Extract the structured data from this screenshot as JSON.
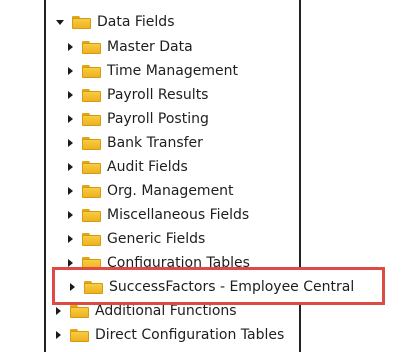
{
  "tree": {
    "root": {
      "label": "Data Fields",
      "expanded": true
    },
    "children": [
      {
        "label": "Master Data"
      },
      {
        "label": "Time Management"
      },
      {
        "label": "Payroll Results"
      },
      {
        "label": "Payroll Posting"
      },
      {
        "label": "Bank Transfer"
      },
      {
        "label": "Audit Fields"
      },
      {
        "label": "Org. Management"
      },
      {
        "label": "Miscellaneous Fields"
      },
      {
        "label": "Generic Fields"
      },
      {
        "label": "Configuration Tables"
      },
      {
        "label": "SuccessFactors - Employee Central"
      }
    ],
    "siblings": [
      {
        "label": "Additional Functions"
      },
      {
        "label": "Direct Configuration Tables"
      }
    ]
  },
  "highlight_color": "#de4b45",
  "folder_color": "#f4c22f"
}
